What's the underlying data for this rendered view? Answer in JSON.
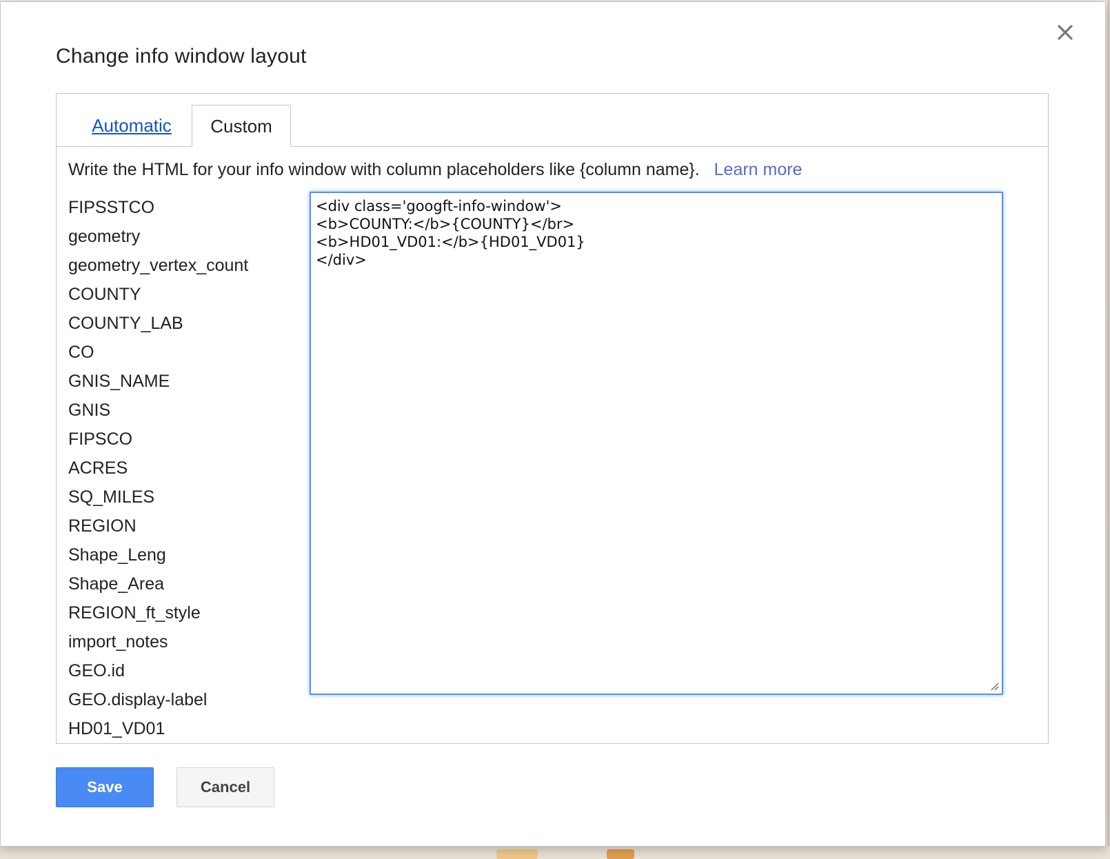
{
  "dialog": {
    "title": "Change info window layout",
    "close_icon": "close-icon"
  },
  "tabs": [
    {
      "label": "Automatic",
      "active": false
    },
    {
      "label": "Custom",
      "active": true
    }
  ],
  "help": {
    "text": "Write the HTML for your info window with column placeholders like {column name}.",
    "learn_more": "Learn more"
  },
  "columns": [
    "FIPSSTCO",
    "geometry",
    "geometry_vertex_count",
    "COUNTY",
    "COUNTY_LAB",
    "CO",
    "GNIS_NAME",
    "GNIS",
    "FIPSCO",
    "ACRES",
    "SQ_MILES",
    "REGION",
    "Shape_Leng",
    "Shape_Area",
    "REGION_ft_style",
    "import_notes",
    "GEO.id",
    "GEO.display-label",
    "HD01_VD01"
  ],
  "editor": {
    "value": "<div class='googft-info-window'>\n<b>COUNTY:</b>{COUNTY}</br>\n<b>HD01_VD01:</b>{HD01_VD01}\n</div>"
  },
  "buttons": {
    "save": "Save",
    "cancel": "Cancel"
  },
  "colors": {
    "accent": "#4a8af4",
    "link": "#1155cc",
    "learn_more": "#5a6ac7",
    "focus_border": "#4d90fe"
  }
}
